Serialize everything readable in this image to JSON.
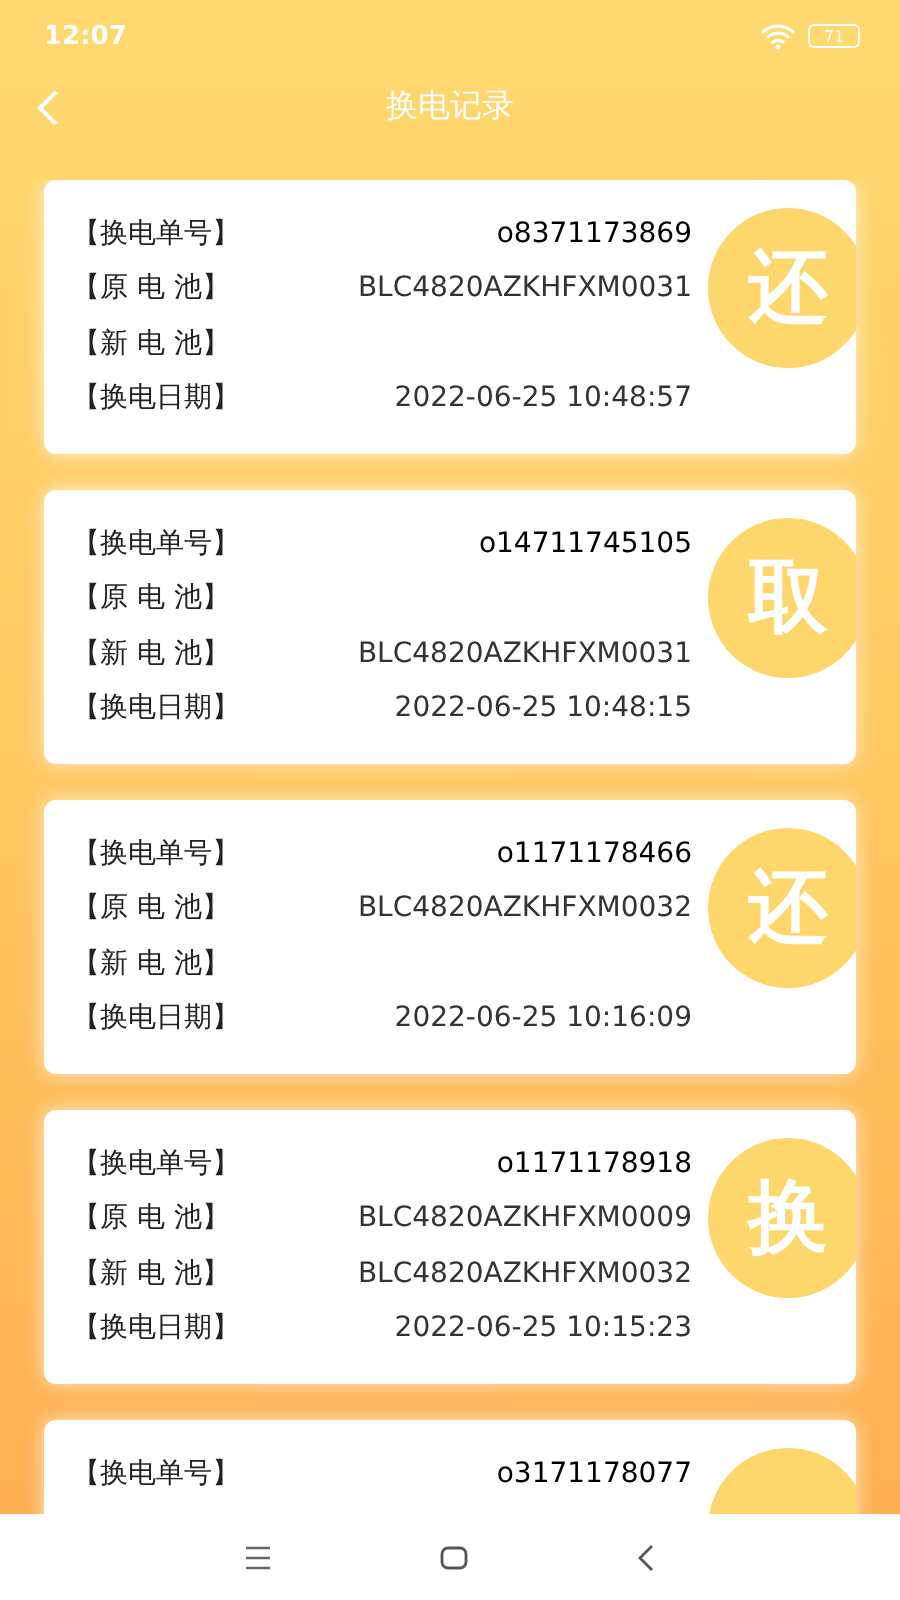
{
  "status_bar": {
    "time": "12:07",
    "battery": "71"
  },
  "header": {
    "title": "换电记录"
  },
  "records": [
    {
      "badge": "还",
      "fields": [
        {
          "label": "【换电单号】",
          "value": "o8371173869",
          "kind": "order"
        },
        {
          "label": "【原 电 池】",
          "value": "BLC4820AZKHFXM0031"
        },
        {
          "label": "【新 电 池】"
        },
        {
          "label": "【换电日期】",
          "value": "2022-06-25 10:48:57"
        }
      ]
    },
    {
      "badge": "取",
      "fields": [
        {
          "label": "【换电单号】",
          "value": "o14711745105",
          "kind": "order"
        },
        {
          "label": "【原 电 池】"
        },
        {
          "label": "【新 电 池】",
          "value": "BLC4820AZKHFXM0031"
        },
        {
          "label": "【换电日期】",
          "value": "2022-06-25 10:48:15"
        }
      ]
    },
    {
      "badge": "还",
      "fields": [
        {
          "label": "【换电单号】",
          "value": "o1171178466",
          "kind": "order"
        },
        {
          "label": "【原 电 池】",
          "value": "BLC4820AZKHFXM0032"
        },
        {
          "label": "【新 电 池】"
        },
        {
          "label": "【换电日期】",
          "value": "2022-06-25 10:16:09"
        }
      ]
    },
    {
      "badge": "换",
      "fields": [
        {
          "label": "【换电单号】",
          "value": "o1171178918",
          "kind": "order"
        },
        {
          "label": "【原 电 池】",
          "value": "BLC4820AZKHFXM0009"
        },
        {
          "label": "【新 电 池】",
          "value": "BLC4820AZKHFXM0032"
        },
        {
          "label": "【换电日期】",
          "value": "2022-06-25 10:15:23"
        }
      ]
    },
    {
      "fields": [
        {
          "label": "【换电单号】",
          "value": "o3171178077",
          "kind": "order"
        }
      ]
    }
  ]
}
